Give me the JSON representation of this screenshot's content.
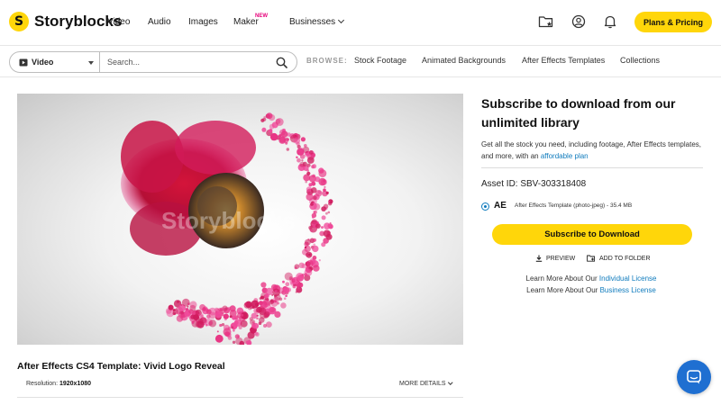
{
  "brand": {
    "name": "Storyblocks",
    "mark": "S"
  },
  "nav": {
    "video": "Video",
    "audio": "Audio",
    "images": "Images",
    "maker": "Maker",
    "maker_badge": "NEW",
    "businesses": "Businesses",
    "plans_button": "Plans & Pricing"
  },
  "search": {
    "type_label": "Video",
    "placeholder": "Search...",
    "browse_label": "BROWSE:",
    "browse_links": [
      "Stock Footage",
      "Animated Backgrounds",
      "After Effects Templates",
      "Collections"
    ]
  },
  "panel": {
    "title": "Subscribe to download from our unlimited library",
    "desc_prefix": "Get all the stock you need, including footage, After Effects templates, and more, with an",
    "desc_link": "affordable plan",
    "asset_id": "Asset ID: SBV-303318408",
    "format_code": "AE",
    "format_desc": "After Effects Template (photo-jpeg) - 35.4 MB",
    "subscribe_button": "Subscribe to Download",
    "preview_button": "PREVIEW",
    "add_folder_button": "ADD TO FOLDER",
    "learn_prefix": "Learn More About Our",
    "individual_link": "Individual License",
    "business_link": "Business License"
  },
  "asset": {
    "title": "After Effects CS4 Template: Vivid Logo Reveal",
    "resolution_label": "Resolution:",
    "resolution_value": "1920x1080",
    "more_details": "MORE DETAILS"
  },
  "colors": {
    "accent_yellow": "#ffd60a",
    "link_blue": "#0f7bbd",
    "chat_blue": "#1f6fd1",
    "particle_pink": "#e0207a"
  },
  "icons": [
    "folder-star-icon",
    "user-circle-icon",
    "bell-icon",
    "video-camera-icon",
    "search-icon",
    "download-icon",
    "add-folder-icon",
    "chat-icon"
  ]
}
